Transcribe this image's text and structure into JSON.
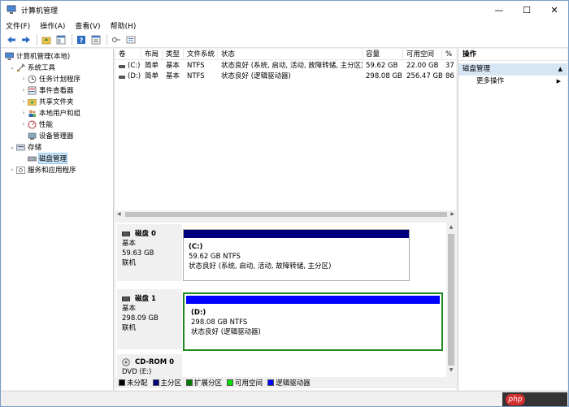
{
  "window": {
    "title": "计算机管理",
    "controls": [
      "—",
      "☐",
      "✕"
    ]
  },
  "menu": [
    "文件(F)",
    "操作(A)",
    "查看(V)",
    "帮助(H)"
  ],
  "tree": {
    "items": [
      {
        "label": "计算机管理(本地)",
        "level": 0,
        "arrow": ""
      },
      {
        "label": "系统工具",
        "level": 1,
        "arrow": "⌄"
      },
      {
        "label": "任务计划程序",
        "level": 2,
        "arrow": "›"
      },
      {
        "label": "事件查看器",
        "level": 2,
        "arrow": "›"
      },
      {
        "label": "共享文件夹",
        "level": 2,
        "arrow": "›"
      },
      {
        "label": "本地用户和组",
        "level": 2,
        "arrow": "›"
      },
      {
        "label": "性能",
        "level": 2,
        "arrow": "›"
      },
      {
        "label": "设备管理器",
        "level": 2,
        "arrow": ""
      },
      {
        "label": "存储",
        "level": 1,
        "arrow": "⌄"
      },
      {
        "label": "磁盘管理",
        "level": 2,
        "arrow": "",
        "selected": true
      },
      {
        "label": "服务和应用程序",
        "level": 1,
        "arrow": "›"
      }
    ]
  },
  "volume_list": {
    "columns": [
      "卷",
      "布局",
      "类型",
      "文件系统",
      "状态",
      "容量",
      "可用空间",
      "%"
    ],
    "rows": [
      [
        "(C:)",
        "简单",
        "基本",
        "NTFS",
        "状态良好 (系统, 启动, 活动, 故障转储, 主分区)",
        "59.62 GB",
        "22.00 GB",
        "37"
      ],
      [
        "(D:)",
        "简单",
        "基本",
        "NTFS",
        "状态良好 (逻辑驱动器)",
        "298.08 GB",
        "256.47 GB",
        "86"
      ]
    ]
  },
  "disks": [
    {
      "name": "磁盘 0",
      "type": "基本",
      "size": "59.63 GB",
      "status": "联机",
      "partition": {
        "name": "(C:)",
        "size": "59.62 GB NTFS",
        "status": "状态良好 (系统, 启动, 活动, 故障转储, 主分区)",
        "bar_color": "#00007f"
      }
    },
    {
      "name": "磁盘 1",
      "type": "基本",
      "size": "298.09 GB",
      "status": "联机",
      "partition": {
        "name": "(D:)",
        "size": "298.08 GB NTFS",
        "status": "状态良好 (逻辑驱动器)",
        "bar_color": "#0000ff"
      }
    },
    {
      "name": "CD-ROM 0",
      "type": "DVD (E:)",
      "size": "",
      "status": ""
    }
  ],
  "legend": [
    {
      "label": "未分配",
      "color": "#000000"
    },
    {
      "label": "主分区",
      "color": "#00007f"
    },
    {
      "label": "扩展分区",
      "color": "#007f00"
    },
    {
      "label": "可用空间",
      "color": "#00e000"
    },
    {
      "label": "逻辑驱动器",
      "color": "#0000ff"
    }
  ],
  "actions": {
    "header": "操作",
    "section": "磁盘管理",
    "items": [
      "更多操作"
    ]
  },
  "watermark": "php"
}
